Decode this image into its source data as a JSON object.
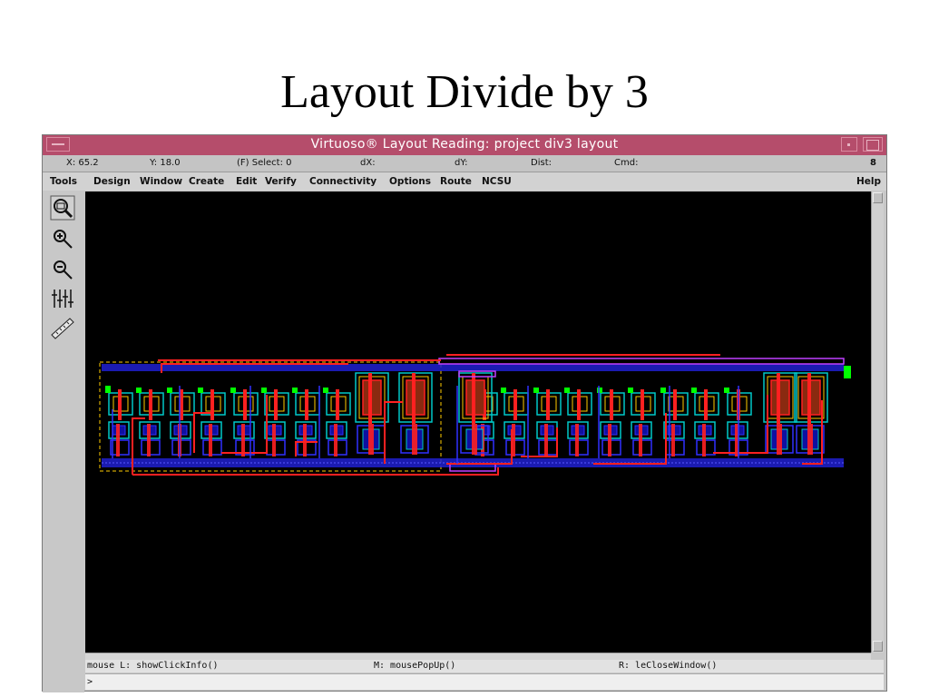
{
  "slide": {
    "title": "Layout Divide by 3"
  },
  "window": {
    "title": "Virtuoso® Layout Reading: project div3 layout",
    "status": {
      "x": "X: 65.2",
      "y": "Y: 18.0",
      "select": "(F) Select: 0",
      "dx": "dX:",
      "dy": "dY:",
      "dist": "Dist:",
      "cmd": "Cmd:",
      "count": "8"
    },
    "menu": {
      "items": [
        "Tools",
        "Design",
        "Window",
        "Create",
        "Edit",
        "Verify",
        "Connectivity",
        "Options",
        "Route",
        "NCSU"
      ],
      "help": "Help"
    },
    "tools": [
      "fit-view-icon",
      "zoom-in-icon",
      "zoom-out-icon",
      "stretch-icon",
      "ruler-icon"
    ],
    "mouse": {
      "left": "mouse L: showClickInfo()",
      "middle": "M: mousePopUp()",
      "right": "R: leCloseWindow()"
    },
    "prompt": ">"
  },
  "colors": {
    "titlebar": "#b54d6b",
    "canvas": "#000000",
    "metal1": "#3030ff",
    "poly": "#ff2020",
    "diffusion": "#00c8c8",
    "active": "#ffcc00",
    "via": "#00ff00",
    "metal2": "#c040ff"
  }
}
